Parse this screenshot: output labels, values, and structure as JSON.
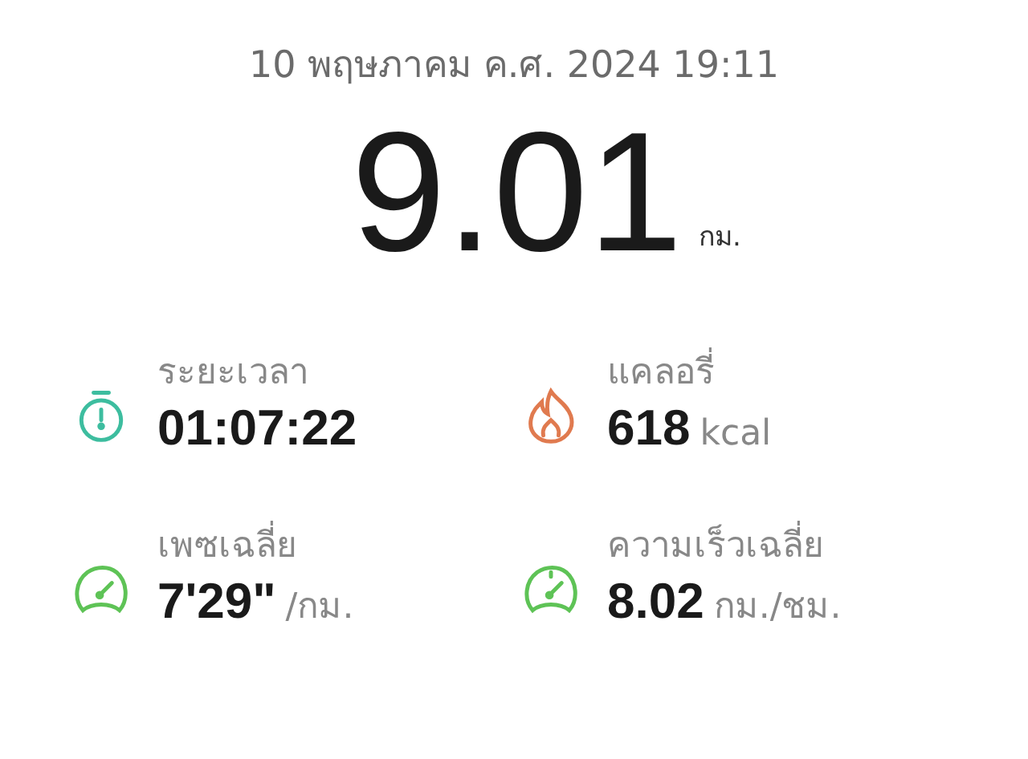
{
  "date": "10 พฤษภาคม ค.ศ. 2024 19:11",
  "distance": {
    "value": "9.01",
    "unit": "กม."
  },
  "stats": [
    {
      "kind": "timer",
      "color": "#3dbd9f",
      "label": "ระยะเวลา",
      "value": "01:07:22"
    },
    {
      "kind": "flame",
      "color": "#e07a4f",
      "label": "แคลอรี่",
      "value": "618",
      "unit": "kcal"
    },
    {
      "kind": "pace",
      "color": "#5ec356",
      "label": "เพซเฉลี่ย",
      "value": "7'29\"",
      "unit": "/กม."
    },
    {
      "kind": "speed",
      "color": "#5ec356",
      "label": "ความเร็วเฉลี่ย",
      "value": "8.02",
      "unit": "กม./ชม."
    }
  ]
}
